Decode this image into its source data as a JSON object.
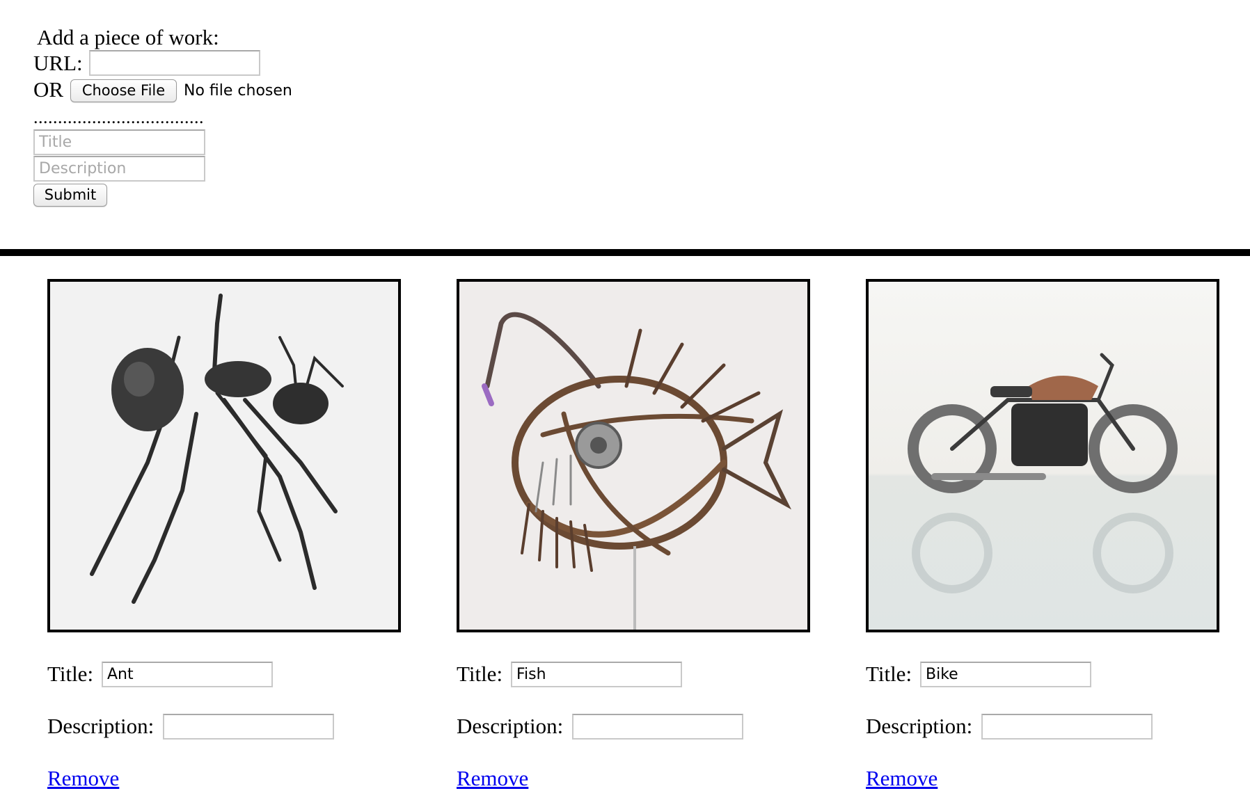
{
  "form": {
    "heading": "Add a piece of work:",
    "url_label": "URL:",
    "url_value": "",
    "or_label": "OR",
    "choose_file_label": "Choose File",
    "no_file_text": "No file chosen",
    "separator": "...................................",
    "title_placeholder": "Title",
    "description_placeholder": "Description",
    "submit_label": "Submit"
  },
  "works": [
    {
      "image": "ant-sculpture",
      "title_label": "Title:",
      "title_value": "Ant",
      "description_label": "Description:",
      "description_value": "",
      "remove_label": "Remove"
    },
    {
      "image": "anglerfish-sculpture",
      "title_label": "Title:",
      "title_value": "Fish",
      "description_label": "Description:",
      "description_value": "",
      "remove_label": "Remove"
    },
    {
      "image": "motorcycle-sculpture",
      "title_label": "Title:",
      "title_value": "Bike",
      "description_label": "Description:",
      "description_value": "",
      "remove_label": "Remove"
    }
  ],
  "colors": {
    "link": "#0000ee",
    "rule": "#000000",
    "input_border": "#c9c9c9"
  }
}
